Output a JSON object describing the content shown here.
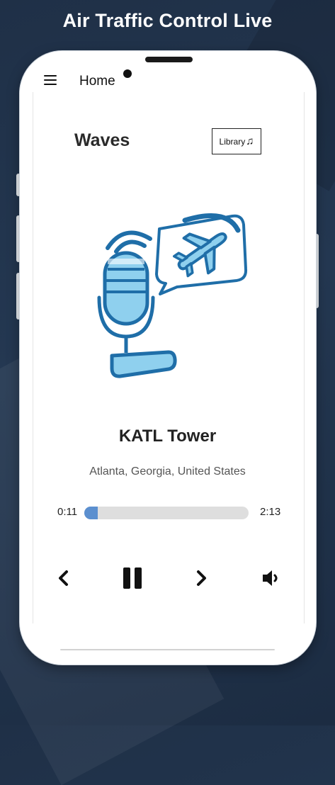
{
  "headline": "Air Traffic Control Live",
  "app_bar": {
    "title": "Home"
  },
  "section": {
    "title": "Waves",
    "library_label": "Library",
    "library_glyph": "♫"
  },
  "player": {
    "station": "KATL Tower",
    "location": "Atlanta, Georgia, United States",
    "elapsed": "0:11",
    "duration": "2:13",
    "progress_fraction": 0.083,
    "controls": [
      "previous-icon",
      "pause-icon",
      "next-icon",
      "volume-icon"
    ]
  },
  "colors": {
    "background": "#243852",
    "accent": "#5b8fcf",
    "illustration_stroke": "#1f6ea8",
    "illustration_fill": "#8fd0ee"
  }
}
